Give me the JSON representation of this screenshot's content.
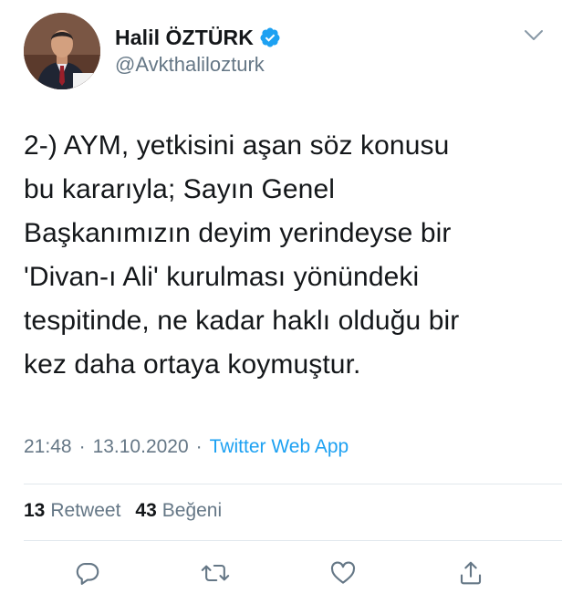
{
  "author": {
    "display_name": "Halil ÖZTÜRK",
    "handle": "@Avkthalilozturk",
    "verified": true,
    "avatar_icon": "profile-photo"
  },
  "tweet": {
    "text": "2-) AYM, yetkisini aşan söz konusu\nbu kararıyla; Sayın Genel\nBaşkanımızın deyim yerindeyse bir\n'Divan-ı Ali' kurulması yönündeki\ntespitinde, ne kadar haklı olduğu bir\nkez daha ortaya koymuştur.",
    "time": "21:48",
    "separator": "·",
    "date": "13.10.2020",
    "source": "Twitter Web App"
  },
  "stats": {
    "retweet_count": "13",
    "retweet_label": "Retweet",
    "like_count": "43",
    "like_label": "Beğeni"
  },
  "actions": {
    "reply_icon": "reply-icon",
    "retweet_icon": "retweet-icon",
    "like_icon": "heart-icon",
    "share_icon": "share-icon"
  },
  "colors": {
    "accent": "#1da1f2",
    "text": "#14171a",
    "muted": "#657786",
    "divider": "#e1e8ed"
  }
}
